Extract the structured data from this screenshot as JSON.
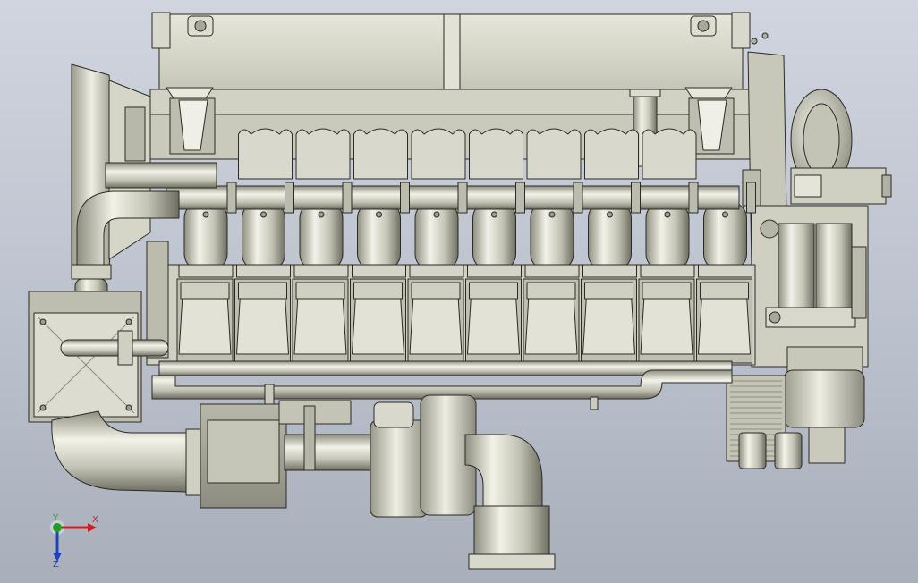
{
  "viewport": {
    "background_top": "#d0d5df",
    "background_bottom": "#a9afba"
  },
  "model": {
    "body_color": "#d4d4c6",
    "shade_color": "#a8a89a",
    "edge_color": "#2a2a26",
    "cylinder_count": 10,
    "exhaust_manifold_color": "#c8c8ba"
  },
  "triad": {
    "x_label": "X",
    "y_label": "Y",
    "z_label": "Z",
    "x_color": "#d02020",
    "y_color": "#20a020",
    "z_color": "#2040c0"
  }
}
